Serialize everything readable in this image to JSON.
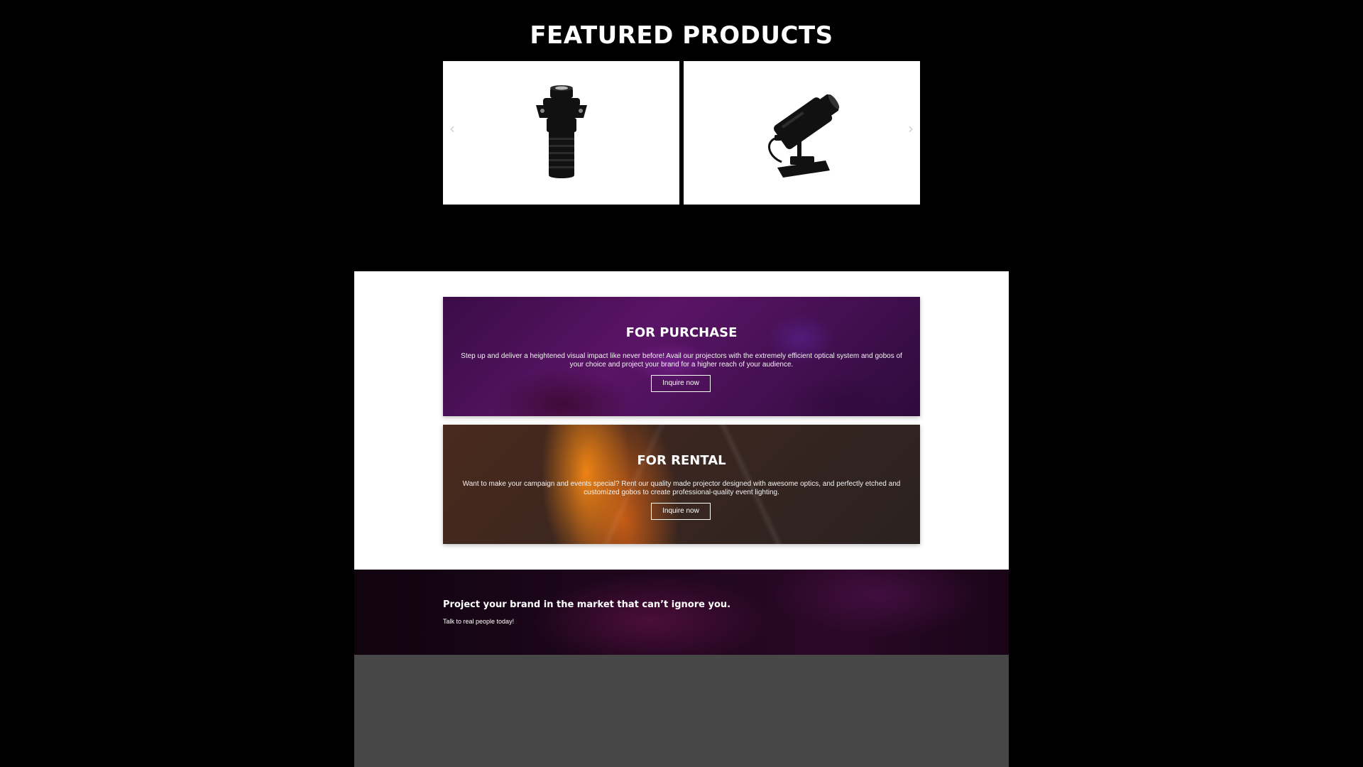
{
  "featured": {
    "title": "FEATURED PRODUCTS",
    "products": [
      {
        "image": "spot-projector-lens-icon"
      },
      {
        "image": "gobo-projector-mount-icon"
      }
    ],
    "prev_arrow": "‹",
    "next_arrow": "›"
  },
  "banners": [
    {
      "title": "FOR PURCHASE",
      "text": "Step up and deliver a heightened visual impact like never before! Avail our projectors with the extremely efficient optical system and gobos of your choice and project your brand for a higher reach of your audience.",
      "button": "Inquire now"
    },
    {
      "title": "FOR RENTAL",
      "text": "Want to make your campaign and events special? Rent our quality made projector designed with awesome optics, and perfectly etched and customized gobos to create professional-quality event lighting.",
      "button": "Inquire now"
    }
  ],
  "cta": {
    "heading": "Project your brand in the market that can’t ignore you.",
    "subtext": "Talk to real people today!"
  },
  "colors": {
    "page_background": "#000000",
    "section_white": "#ffffff",
    "footer_grey": "#474747"
  }
}
